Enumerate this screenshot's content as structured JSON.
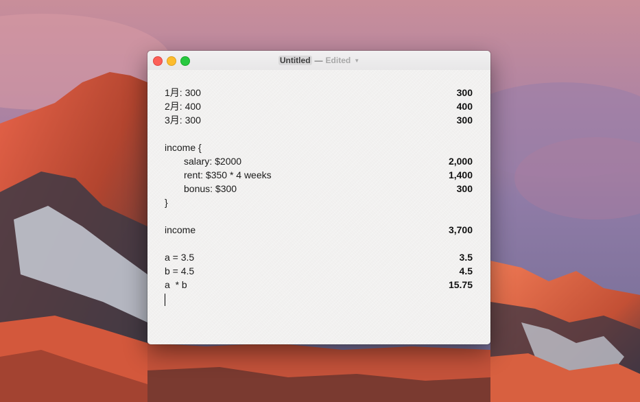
{
  "window": {
    "title": "Untitled",
    "separator": "—",
    "status": "Edited",
    "chevron_icon": "chevron-down-icon"
  },
  "lines": [
    {
      "expr": "1月: 300",
      "result": "300"
    },
    {
      "expr": "2月: 400",
      "result": "400"
    },
    {
      "expr": "3月: 300",
      "result": "300"
    },
    {
      "expr": "",
      "result": ""
    },
    {
      "expr": "income {",
      "result": ""
    },
    {
      "expr": "salary: $2000",
      "result": "2,000"
    },
    {
      "expr": "rent: $350 * 4 weeks",
      "result": "1,400"
    },
    {
      "expr": "bonus: $300",
      "result": "300"
    },
    {
      "expr": "}",
      "result": ""
    },
    {
      "expr": "",
      "result": ""
    },
    {
      "expr": "income",
      "result": "3,700"
    },
    {
      "expr": "",
      "result": ""
    },
    {
      "expr": "a = 3.5",
      "result": "3.5"
    },
    {
      "expr": "b = 4.5",
      "result": "4.5"
    },
    {
      "expr": "a  * b",
      "result": "15.75"
    }
  ],
  "colors": {
    "close": "#fc5f57",
    "minimize": "#fdbc2e",
    "maximize": "#29c840",
    "paper": "#f2f1f0"
  }
}
